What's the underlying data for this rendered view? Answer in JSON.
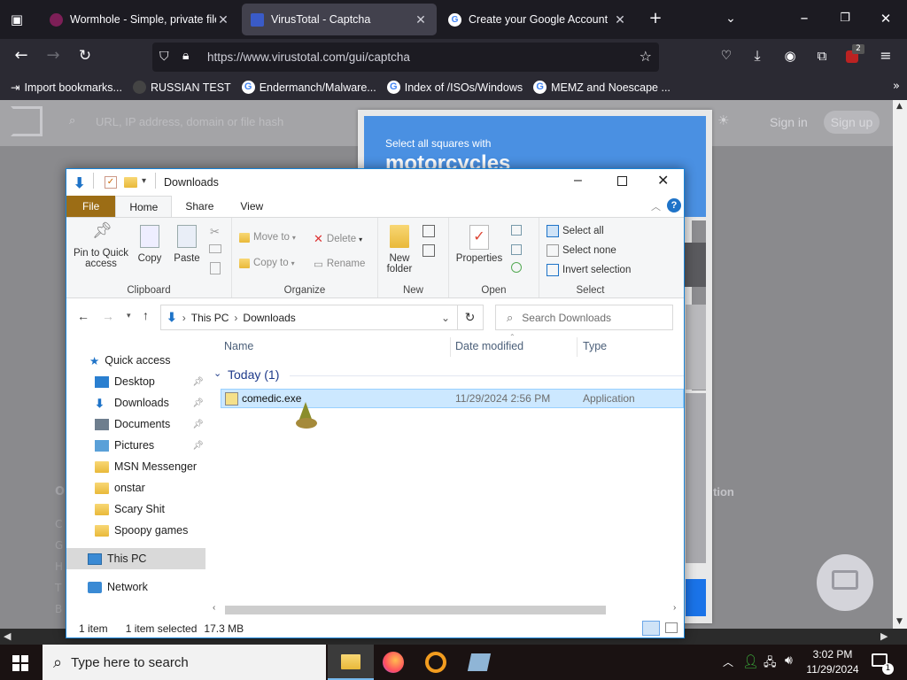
{
  "browser": {
    "tabs": [
      {
        "title": "Wormhole - Simple, private file",
        "active": false,
        "favicon_color": "#7d1f57"
      },
      {
        "title": "VirusTotal - Captcha",
        "active": true,
        "favicon_color": "#3a5bc7"
      },
      {
        "title": "Create your Google Account",
        "active": false,
        "favicon_color": "#ffffff"
      }
    ],
    "url": "https://www.virustotal.com/gui/captcha",
    "bookmarks": [
      "Import bookmarks...",
      "RUSSIAN TEST",
      "Endermanch/Malware...",
      "Index of /ISOs/Windows",
      "MEMZ and Noescape ..."
    ],
    "extension_badge": "2"
  },
  "page": {
    "search_placeholder": "URL, IP address, domain or file hash",
    "sign_in": "Sign in",
    "sign_up": "Sign up",
    "captcha_instruction": "Select all squares with",
    "captcha_target": "motorcycles",
    "footer_heading_fragment": "tion",
    "footer_left_fragment": "O"
  },
  "explorer": {
    "title": "Downloads",
    "ribbon_tabs": [
      "File",
      "Home",
      "Share",
      "View"
    ],
    "groups": {
      "clipboard": {
        "label": "Clipboard",
        "pin": "Pin to Quick access",
        "copy": "Copy",
        "paste": "Paste"
      },
      "organize": {
        "label": "Organize",
        "move_to": "Move to",
        "copy_to": "Copy to",
        "delete": "Delete",
        "rename": "Rename"
      },
      "new": {
        "label": "New",
        "new_folder": "New folder"
      },
      "open": {
        "label": "Open",
        "properties": "Properties"
      },
      "select": {
        "label": "Select",
        "select_all": "Select all",
        "select_none": "Select none",
        "invert": "Invert selection"
      }
    },
    "breadcrumb": [
      "This PC",
      "Downloads"
    ],
    "search_placeholder": "Search Downloads",
    "nav": {
      "quick_access": "Quick access",
      "pinned": [
        "Desktop",
        "Downloads",
        "Documents",
        "Pictures"
      ],
      "folders": [
        "MSN Messenger",
        "onstar",
        "Scary Shit",
        "Spoopy games"
      ],
      "this_pc": "This PC",
      "network": "Network"
    },
    "columns": [
      "Name",
      "Date modified",
      "Type"
    ],
    "group_header": "Today (1)",
    "files": [
      {
        "name": "comedic.exe",
        "date": "11/29/2024 2:56 PM",
        "type": "Application",
        "selected": true
      }
    ],
    "status": {
      "count": "1 item",
      "selected": "1 item selected",
      "size": "17.3 MB"
    }
  },
  "taskbar": {
    "search_placeholder": "Type here to search",
    "time": "3:02 PM",
    "date": "11/29/2024",
    "notification_count": "1"
  }
}
